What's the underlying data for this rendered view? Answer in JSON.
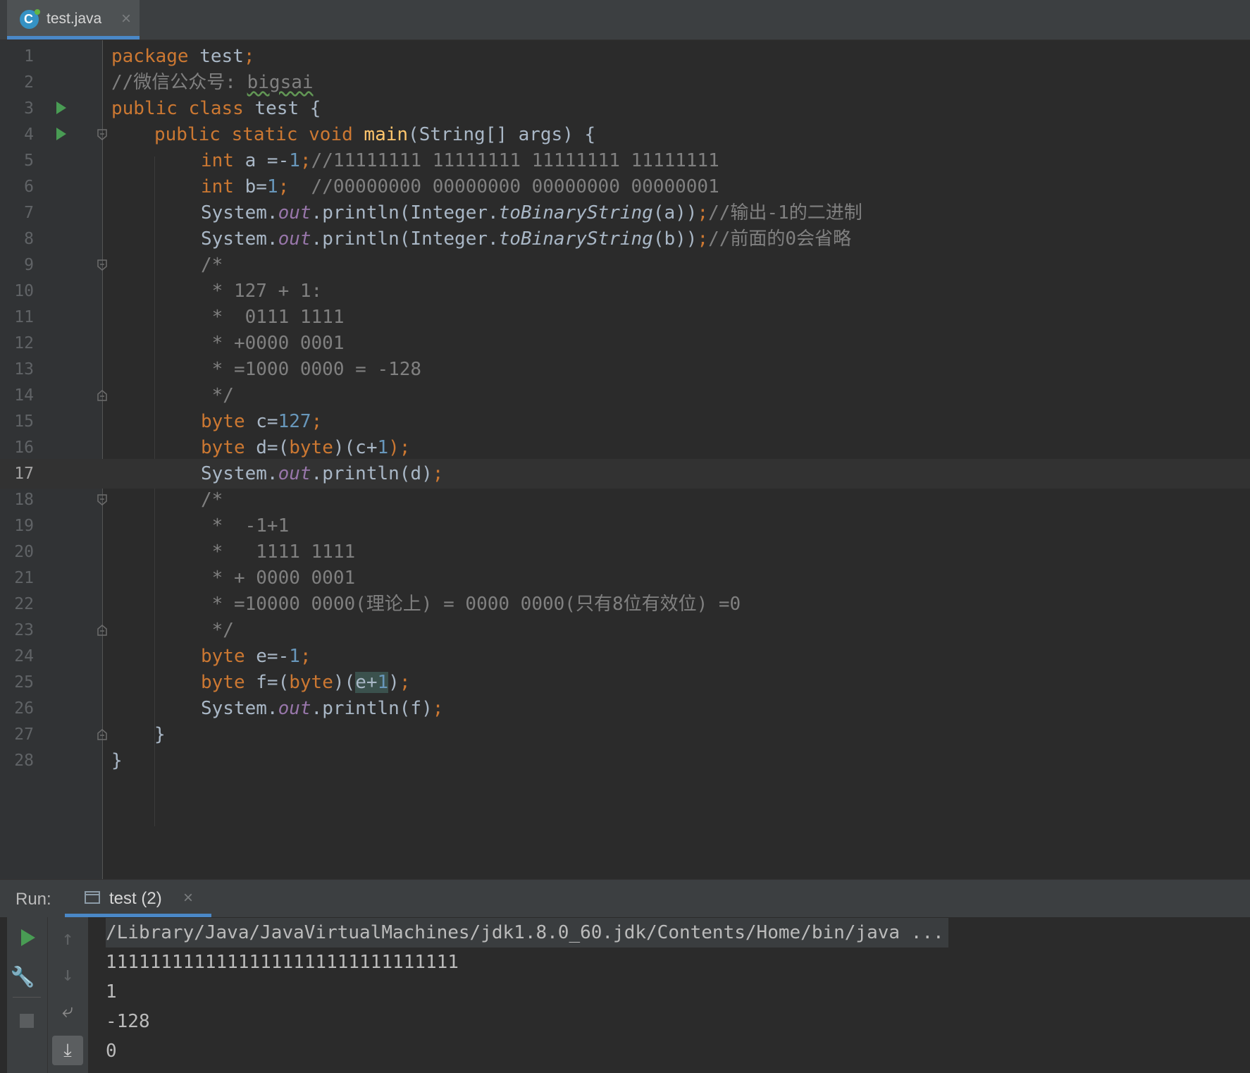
{
  "tab": {
    "label": "test.java",
    "close": "×",
    "icon": "java-class-icon"
  },
  "editor": {
    "lines": [
      "1",
      "2",
      "3",
      "4",
      "5",
      "6",
      "7",
      "8",
      "9",
      "10",
      "11",
      "12",
      "13",
      "14",
      "15",
      "16",
      "17",
      "18",
      "19",
      "20",
      "21",
      "22",
      "23",
      "24",
      "25",
      "26",
      "27",
      "28"
    ],
    "current_line": "17",
    "code": {
      "l1": [
        "package",
        " test",
        ";"
      ],
      "l2": [
        "//微信公众号: ",
        "bigsai"
      ],
      "l3": [
        "public class",
        " test {"
      ],
      "l4": [
        "public static void",
        " ",
        "main",
        "(String[] args) {"
      ],
      "l5": [
        "int",
        " a =-",
        "1",
        ";",
        "//11111111 11111111 11111111 11111111"
      ],
      "l6": [
        "int",
        " b=",
        "1",
        ";",
        "  //00000000 00000000 00000000 00000001"
      ],
      "l7": [
        "System.",
        "out",
        ".println(Integer.",
        "toBinaryString",
        "(a))",
        ";",
        "//输出-1的二进制"
      ],
      "l8": [
        "System.",
        "out",
        ".println(Integer.",
        "toBinaryString",
        "(b))",
        ";",
        "//前面的0会省略"
      ],
      "l9": "/*",
      "l10": " * 127 + 1:",
      "l11": " *  0111 1111",
      "l12": " * +0000 0001",
      "l13": " * =1000 0000 = -128",
      "l14": " */",
      "l15": [
        "byte",
        " c=",
        "127",
        ";"
      ],
      "l16": [
        "byte",
        " d=(",
        "byte",
        ")(c+",
        "1",
        ");"
      ],
      "l17": [
        "System.",
        "out",
        ".println(d)",
        ";"
      ],
      "l18": "/*",
      "l19": " *  -1+1",
      "l20": " *   1111 1111",
      "l21": " * + 0000 0001",
      "l22": " * =10000 0000(理论上) = 0000 0000(只有8位有效位) =0",
      "l23": " */",
      "l24": [
        "byte",
        " e=-",
        "1",
        ";"
      ],
      "l25": [
        "byte",
        " f=(",
        "byte",
        ")(",
        "e+",
        "1",
        ")",
        ";"
      ],
      "l26": [
        "System.",
        "out",
        ".println(f)",
        ";"
      ],
      "l27": "}",
      "l28": "}"
    }
  },
  "run_panel": {
    "label": "Run:",
    "tab_label": "test (2)",
    "tab_close": "×",
    "console": [
      "/Library/Java/JavaVirtualMachines/jdk1.8.0_60.jdk/Contents/Home/bin/java ...",
      "11111111111111111111111111111111",
      "1",
      "-128",
      "0"
    ]
  },
  "colors": {
    "keyword": "#cc7832",
    "number": "#6897bb",
    "comment": "#808080",
    "method": "#ffc66d",
    "static_field": "#9876aa",
    "accent": "#4a88c7",
    "run_green": "#499c54"
  }
}
